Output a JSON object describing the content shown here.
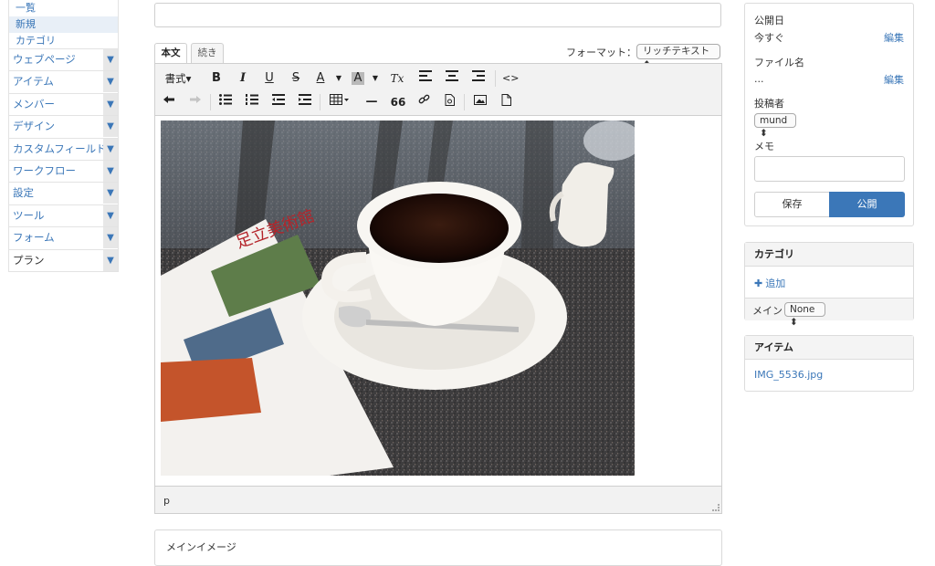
{
  "sidebar": {
    "sub_items": [
      "一覧",
      "新規",
      "カテゴリ"
    ],
    "items": [
      {
        "label": "ウェブページ"
      },
      {
        "label": "アイテム"
      },
      {
        "label": "メンバー"
      },
      {
        "label": "デザイン"
      },
      {
        "label": "カスタムフィールド"
      },
      {
        "label": "ワークフロー"
      },
      {
        "label": "設定"
      },
      {
        "label": "ツール"
      },
      {
        "label": "フォーム"
      },
      {
        "label": "プラン"
      }
    ],
    "chevron": "▼"
  },
  "editor": {
    "tabs": [
      "本文",
      "続き"
    ],
    "format_label": "フォーマット：",
    "format_value": "リッチテキスト ⬍",
    "toolbar": {
      "format_menu": "書式▾",
      "bold": "B",
      "italic": "I",
      "underline": "U",
      "strike": "S",
      "font_color": "A",
      "bg_color": "A",
      "clear_format": "Tx",
      "source": "<>",
      "hr": "—",
      "blockquote": "66"
    },
    "statusbar_path": "p"
  },
  "main_image": {
    "label": "メインイメージ"
  },
  "publish": {
    "publish_date_label": "公開日",
    "publish_date_value": "今すぐ",
    "edit_label": "編集",
    "filename_label": "ファイル名",
    "filename_value": "...",
    "author_label": "投稿者",
    "author_value": "mund ⬍",
    "memo_label": "メモ",
    "save_label": "保存",
    "publish_label": "公開"
  },
  "category": {
    "title": "カテゴリ",
    "add_label": "追加",
    "main_label": "メイン",
    "main_value": "None ⬍"
  },
  "items": {
    "title": "アイテム",
    "file": "IMG_5536.jpg"
  }
}
